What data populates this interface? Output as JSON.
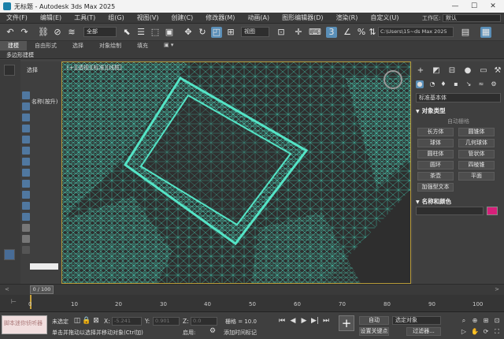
{
  "window": {
    "title": "无标题 - Autodesk 3ds Max 2025",
    "minimize": "—",
    "maximize": "☐",
    "close": "✕"
  },
  "menu": {
    "items": [
      "文件(F)",
      "编辑(E)",
      "工具(T)",
      "组(G)",
      "视图(V)",
      "创建(C)",
      "修改器(M)",
      "动画(A)",
      "图形编辑器(D)",
      "渲染(R)",
      "自定义(U)"
    ],
    "workspace_label": "工作区:",
    "workspace_value": "默认"
  },
  "toolbar": {
    "selection_filter": "全部",
    "view_mode": "视图",
    "project_path": "C:\\Users\\15~ds Max 2025"
  },
  "ribbon": {
    "tabs": [
      "建模",
      "自由形式",
      "选择",
      "对象绘制",
      "填充"
    ],
    "active_tab": "建模",
    "sub_label": "多边形建模"
  },
  "scene_explorer": {
    "header": "选择",
    "column": "名称(按升)"
  },
  "viewport": {
    "label": "[+][透视][标准][线框]"
  },
  "command_panel": {
    "dropdown": "标准基本体",
    "section_object_type": "对象类型",
    "autogrid": "自动栅格",
    "buttons": [
      "长方体",
      "圆锥体",
      "球体",
      "几何球体",
      "圆柱体",
      "管状体",
      "圆环",
      "四棱锥",
      "茶壶",
      "平面",
      "加强型文本"
    ],
    "section_name_color": "名称和颜色",
    "color": "#d6207a"
  },
  "timeline": {
    "slider_label": "0 / 100",
    "ticks": [
      "0",
      "10",
      "20",
      "30",
      "40",
      "50",
      "60",
      "70",
      "80",
      "90",
      "100"
    ]
  },
  "status": {
    "maxscript": "脚本迷你侦听器",
    "selected": "未选定",
    "prompt": "单击并拖动以选择并移动对象(Ctrl加)",
    "x_label": "X:",
    "x_value": "-5.241",
    "y_label": "Y:",
    "y_value": "0.901",
    "z_label": "Z:",
    "z_value": "0.0",
    "grid": "栅格 = 10.0",
    "enabled": "启用:",
    "add_tag": "添加时间标记",
    "auto_key": "自动",
    "set_key": "设置关键点",
    "selected_objects": "选定对象",
    "key_filters": "过滤器..."
  }
}
